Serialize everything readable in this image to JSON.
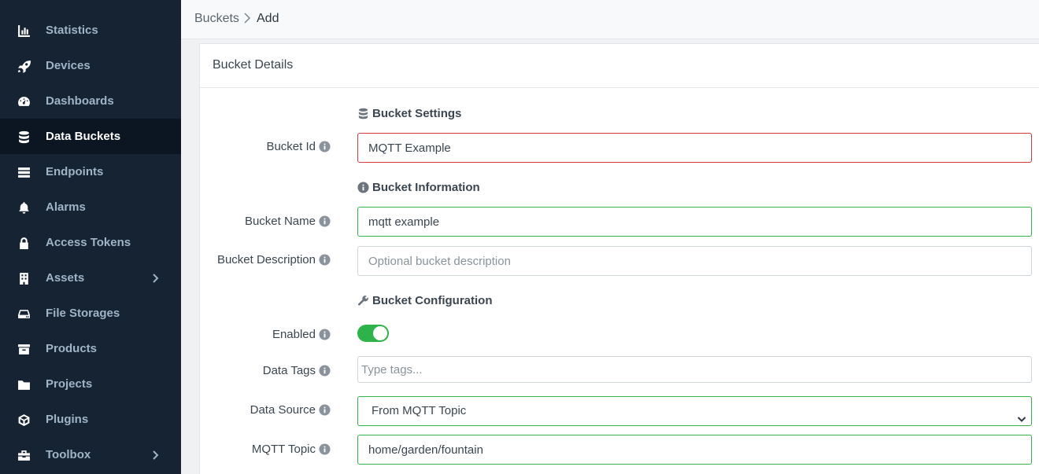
{
  "sidebar": {
    "items": [
      {
        "label": "Statistics",
        "icon": "chart-bar-icon"
      },
      {
        "label": "Devices",
        "icon": "rocket-icon"
      },
      {
        "label": "Dashboards",
        "icon": "gauge-icon"
      },
      {
        "label": "Data Buckets",
        "icon": "database-icon",
        "active": true
      },
      {
        "label": "Endpoints",
        "icon": "server-icon"
      },
      {
        "label": "Alarms",
        "icon": "bell-icon"
      },
      {
        "label": "Access Tokens",
        "icon": "lock-icon"
      },
      {
        "label": "Assets",
        "icon": "building-icon",
        "expandable": true
      },
      {
        "label": "File Storages",
        "icon": "hdd-icon"
      },
      {
        "label": "Products",
        "icon": "box-icon"
      },
      {
        "label": "Projects",
        "icon": "folder-icon"
      },
      {
        "label": "Plugins",
        "icon": "cube-icon"
      },
      {
        "label": "Toolbox",
        "icon": "toolbox-icon",
        "expandable": true
      }
    ]
  },
  "breadcrumb": {
    "parent": "Buckets",
    "current": "Add"
  },
  "card": {
    "title": "Bucket Details"
  },
  "sections": {
    "settings": "Bucket Settings",
    "information": "Bucket Information",
    "configuration": "Bucket Configuration"
  },
  "fields": {
    "bucket_id": {
      "label": "Bucket Id",
      "value": "MQTT Example"
    },
    "bucket_name": {
      "label": "Bucket Name",
      "value": "mqtt example"
    },
    "bucket_description": {
      "label": "Bucket Description",
      "value": "",
      "placeholder": "Optional bucket description"
    },
    "enabled": {
      "label": "Enabled",
      "checked": true
    },
    "data_tags": {
      "label": "Data Tags",
      "placeholder": "Type tags..."
    },
    "data_source": {
      "label": "Data Source",
      "selected": "From MQTT Topic"
    },
    "mqtt_topic": {
      "label": "MQTT Topic",
      "value": "home/garden/fountain"
    }
  },
  "colors": {
    "sidebar_bg": "#162332",
    "sidebar_active_bg": "#0c1622",
    "valid": "#34b34a",
    "invalid": "#d93b3b",
    "toggle_on": "#2db34a"
  }
}
